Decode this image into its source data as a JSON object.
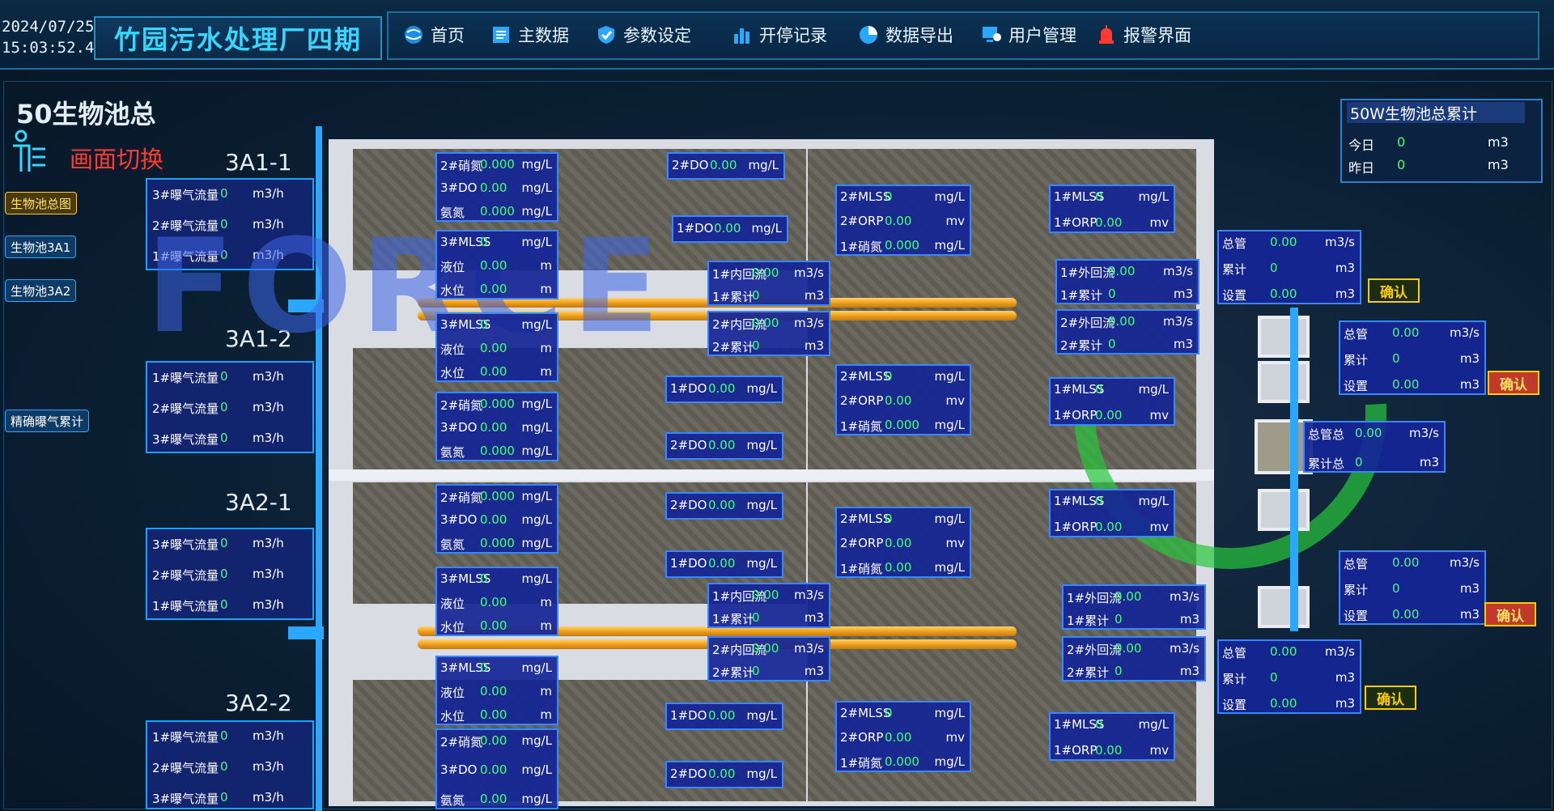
{
  "header": {
    "date": "2024/07/25",
    "time": "15:03:52.4",
    "title": "竹园污水处理厂四期"
  },
  "nav": [
    {
      "label": "首页",
      "icon": "globe-icon"
    },
    {
      "label": "主数据",
      "icon": "document-icon"
    },
    {
      "label": "参数设定",
      "icon": "shield-icon"
    },
    {
      "label": "开停记录",
      "icon": "bar-chart-icon"
    },
    {
      "label": "数据导出",
      "icon": "pie-chart-icon"
    },
    {
      "label": "用户管理",
      "icon": "user-monitor-icon"
    },
    {
      "label": "报警界面",
      "icon": "alarm-icon"
    }
  ],
  "left": {
    "pool_title": "50生物池总",
    "switch_label": "画面切换",
    "buttons": [
      "生物池总图",
      "生物池3A1",
      "生物池3A2",
      "精确曝气累计"
    ]
  },
  "sections": [
    "3A1-1",
    "3A1-2",
    "3A2-1",
    "3A2-2"
  ],
  "aeration": [
    {
      "rows": [
        {
          "label": "3#曝气流量",
          "value": "0",
          "unit": "m3/h"
        },
        {
          "label": "2#曝气流量",
          "value": "0",
          "unit": "m3/h"
        },
        {
          "label": "1#曝气流量",
          "value": "0",
          "unit": "m3/h"
        }
      ]
    },
    {
      "rows": [
        {
          "label": "1#曝气流量",
          "value": "0",
          "unit": "m3/h"
        },
        {
          "label": "2#曝气流量",
          "value": "0",
          "unit": "m3/h"
        },
        {
          "label": "3#曝气流量",
          "value": "0",
          "unit": "m3/h"
        }
      ]
    },
    {
      "rows": [
        {
          "label": "3#曝气流量",
          "value": "0",
          "unit": "m3/h"
        },
        {
          "label": "2#曝气流量",
          "value": "0",
          "unit": "m3/h"
        },
        {
          "label": "1#曝气流量",
          "value": "0",
          "unit": "m3/h"
        }
      ]
    },
    {
      "rows": [
        {
          "label": "1#曝气流量",
          "value": "0",
          "unit": "m3/h"
        },
        {
          "label": "2#曝气流量",
          "value": "0",
          "unit": "m3/h"
        },
        {
          "label": "3#曝气流量",
          "value": "0",
          "unit": "m3/h"
        }
      ]
    }
  ],
  "total": {
    "title": "50W生物池总累计",
    "rows": [
      {
        "label": "今日",
        "value": "0",
        "unit": "m3"
      },
      {
        "label": "昨日",
        "value": "0",
        "unit": "m3"
      }
    ]
  },
  "confirm_label": "确认",
  "watermark": "FORCE",
  "boxes": [
    {
      "rows": [
        [
          "2#硝氮",
          "0.000",
          "mg/L"
        ],
        [
          "3#DO",
          "0.00",
          "mg/L"
        ],
        [
          "氨氮",
          "0.000",
          "mg/L"
        ]
      ]
    },
    {
      "rows": [
        [
          "2#DO",
          "0.00",
          "mg/L"
        ]
      ]
    },
    {
      "rows": [
        [
          "1#DO",
          "0.00",
          "mg/L"
        ]
      ]
    },
    {
      "rows": [
        [
          "3#MLSS",
          "0",
          "mg/L"
        ],
        [
          "液位",
          "0.00",
          "m"
        ],
        [
          "水位",
          "0.00",
          "m"
        ]
      ]
    },
    {
      "rows": [
        [
          "3#MLSS",
          "0",
          "mg/L"
        ],
        [
          "液位",
          "0.00",
          "m"
        ],
        [
          "水位",
          "0.00",
          "m"
        ]
      ]
    },
    {
      "rows": [
        [
          "1#内回流",
          "0.00",
          "m3/s"
        ],
        [
          "1#累计",
          "0",
          "m3"
        ]
      ]
    },
    {
      "rows": [
        [
          "2#内回流",
          "0.00",
          "m3/s"
        ],
        [
          "2#累计",
          "0",
          "m3"
        ]
      ]
    },
    {
      "rows": [
        [
          "2#MLSS",
          "0",
          "mg/L"
        ],
        [
          "2#ORP",
          "0.00",
          "mv"
        ],
        [
          "1#硝氮",
          "0.000",
          "mg/L"
        ]
      ]
    },
    {
      "rows": [
        [
          "1#MLSS",
          "0",
          "mg/L"
        ],
        [
          "1#ORP",
          "0.00",
          "mv"
        ]
      ]
    },
    {
      "rows": [
        [
          "1#外回流",
          "0.00",
          "m3/s"
        ],
        [
          "1#累计",
          "0",
          "m3"
        ]
      ]
    },
    {
      "rows": [
        [
          "2#外回流",
          "0.00",
          "m3/s"
        ],
        [
          "2#累计",
          "0",
          "m3"
        ]
      ]
    },
    {
      "rows": [
        [
          "1#DO",
          "0.00",
          "mg/L"
        ]
      ]
    },
    {
      "rows": [
        [
          "2#硝氮",
          "0.000",
          "mg/L"
        ],
        [
          "3#DO",
          "0.00",
          "mg/L"
        ],
        [
          "氨氮",
          "0.000",
          "mg/L"
        ]
      ]
    },
    {
      "rows": [
        [
          "2#DO",
          "0.00",
          "mg/L"
        ]
      ]
    },
    {
      "rows": [
        [
          "2#MLSS",
          "0",
          "mg/L"
        ],
        [
          "2#ORP",
          "0.00",
          "mv"
        ],
        [
          "1#硝氮",
          "0.000",
          "mg/L"
        ]
      ]
    },
    {
      "rows": [
        [
          "1#MLSS",
          "0",
          "mg/L"
        ],
        [
          "1#ORP",
          "0.00",
          "mv"
        ]
      ]
    },
    {
      "rows": [
        [
          "总管",
          "0.00",
          "m3/s"
        ],
        [
          "累计",
          "0",
          "m3"
        ],
        [
          "设置",
          "0.00",
          "m3"
        ]
      ]
    },
    {
      "rows": [
        [
          "总管",
          "0.00",
          "m3/s"
        ],
        [
          "累计",
          "0",
          "m3"
        ],
        [
          "设置",
          "0.00",
          "m3"
        ]
      ]
    },
    {
      "rows": [
        [
          "总管总",
          "0.00",
          "m3/s"
        ],
        [
          "累计总",
          "0",
          "m3"
        ]
      ]
    },
    {
      "rows": [
        [
          "2#硝氮",
          "0.000",
          "mg/L"
        ],
        [
          "3#DO",
          "0.00",
          "mg/L"
        ],
        [
          "氨氮",
          "0.000",
          "mg/L"
        ]
      ]
    },
    {
      "rows": [
        [
          "2#DO",
          "0.00",
          "mg/L"
        ]
      ]
    },
    {
      "rows": [
        [
          "1#DO",
          "0.00",
          "mg/L"
        ]
      ]
    },
    {
      "rows": [
        [
          "3#MLSS",
          "0",
          "mg/L"
        ],
        [
          "液位",
          "0.00",
          "m"
        ],
        [
          "水位",
          "0.00",
          "m"
        ]
      ]
    },
    {
      "rows": [
        [
          "1#内回流",
          "0.00",
          "m3/s"
        ],
        [
          "1#累计",
          "0",
          "m3"
        ]
      ]
    },
    {
      "rows": [
        [
          "2#内回流",
          "0.00",
          "m3/s"
        ],
        [
          "2#累计",
          "0",
          "m3"
        ]
      ]
    },
    {
      "rows": [
        [
          "2#MLSS",
          "0",
          "mg/L"
        ],
        [
          "2#ORP",
          "0.00",
          "mv"
        ],
        [
          "1#硝氮",
          "0.00",
          "mg/L"
        ]
      ]
    },
    {
      "rows": [
        [
          "1#MLSS",
          "0",
          "mg/L"
        ],
        [
          "1#ORP",
          "0.00",
          "mv"
        ]
      ]
    },
    {
      "rows": [
        [
          "1#外回流",
          "0.00",
          "m3/s"
        ],
        [
          "1#累计",
          "0",
          "m3"
        ]
      ]
    },
    {
      "rows": [
        [
          "2#外回流",
          "0.00",
          "m3/s"
        ],
        [
          "2#累计",
          "0",
          "m3"
        ]
      ]
    },
    {
      "rows": [
        [
          "总管",
          "0.00",
          "m3/s"
        ],
        [
          "累计",
          "0",
          "m3"
        ],
        [
          "设置",
          "0.00",
          "m3"
        ]
      ]
    },
    {
      "rows": [
        [
          "3#MLSS",
          "0",
          "mg/L"
        ],
        [
          "液位",
          "0.00",
          "m"
        ],
        [
          "水位",
          "0.00",
          "m"
        ]
      ]
    },
    {
      "rows": [
        [
          "1#DO",
          "0.00",
          "mg/L"
        ]
      ]
    },
    {
      "rows": [
        [
          "2#硝氮",
          "0.00",
          "mg/L"
        ],
        [
          "3#DO",
          "0.00",
          "mg/L"
        ],
        [
          "氨氮",
          "0.00",
          "mg/L"
        ]
      ]
    },
    {
      "rows": [
        [
          "2#DO",
          "0.00",
          "mg/L"
        ]
      ]
    },
    {
      "rows": [
        [
          "2#MLSS",
          "0",
          "mg/L"
        ],
        [
          "2#ORP",
          "0.00",
          "mv"
        ],
        [
          "1#硝氮",
          "0.000",
          "mg/L"
        ]
      ]
    },
    {
      "rows": [
        [
          "1#MLSS",
          "0",
          "mg/L"
        ],
        [
          "1#ORP",
          "0.00",
          "mv"
        ]
      ]
    },
    {
      "rows": [
        [
          "总管",
          "0.00",
          "m3/s"
        ],
        [
          "累计",
          "0",
          "m3"
        ],
        [
          "设置",
          "0.00",
          "m3"
        ]
      ]
    }
  ]
}
